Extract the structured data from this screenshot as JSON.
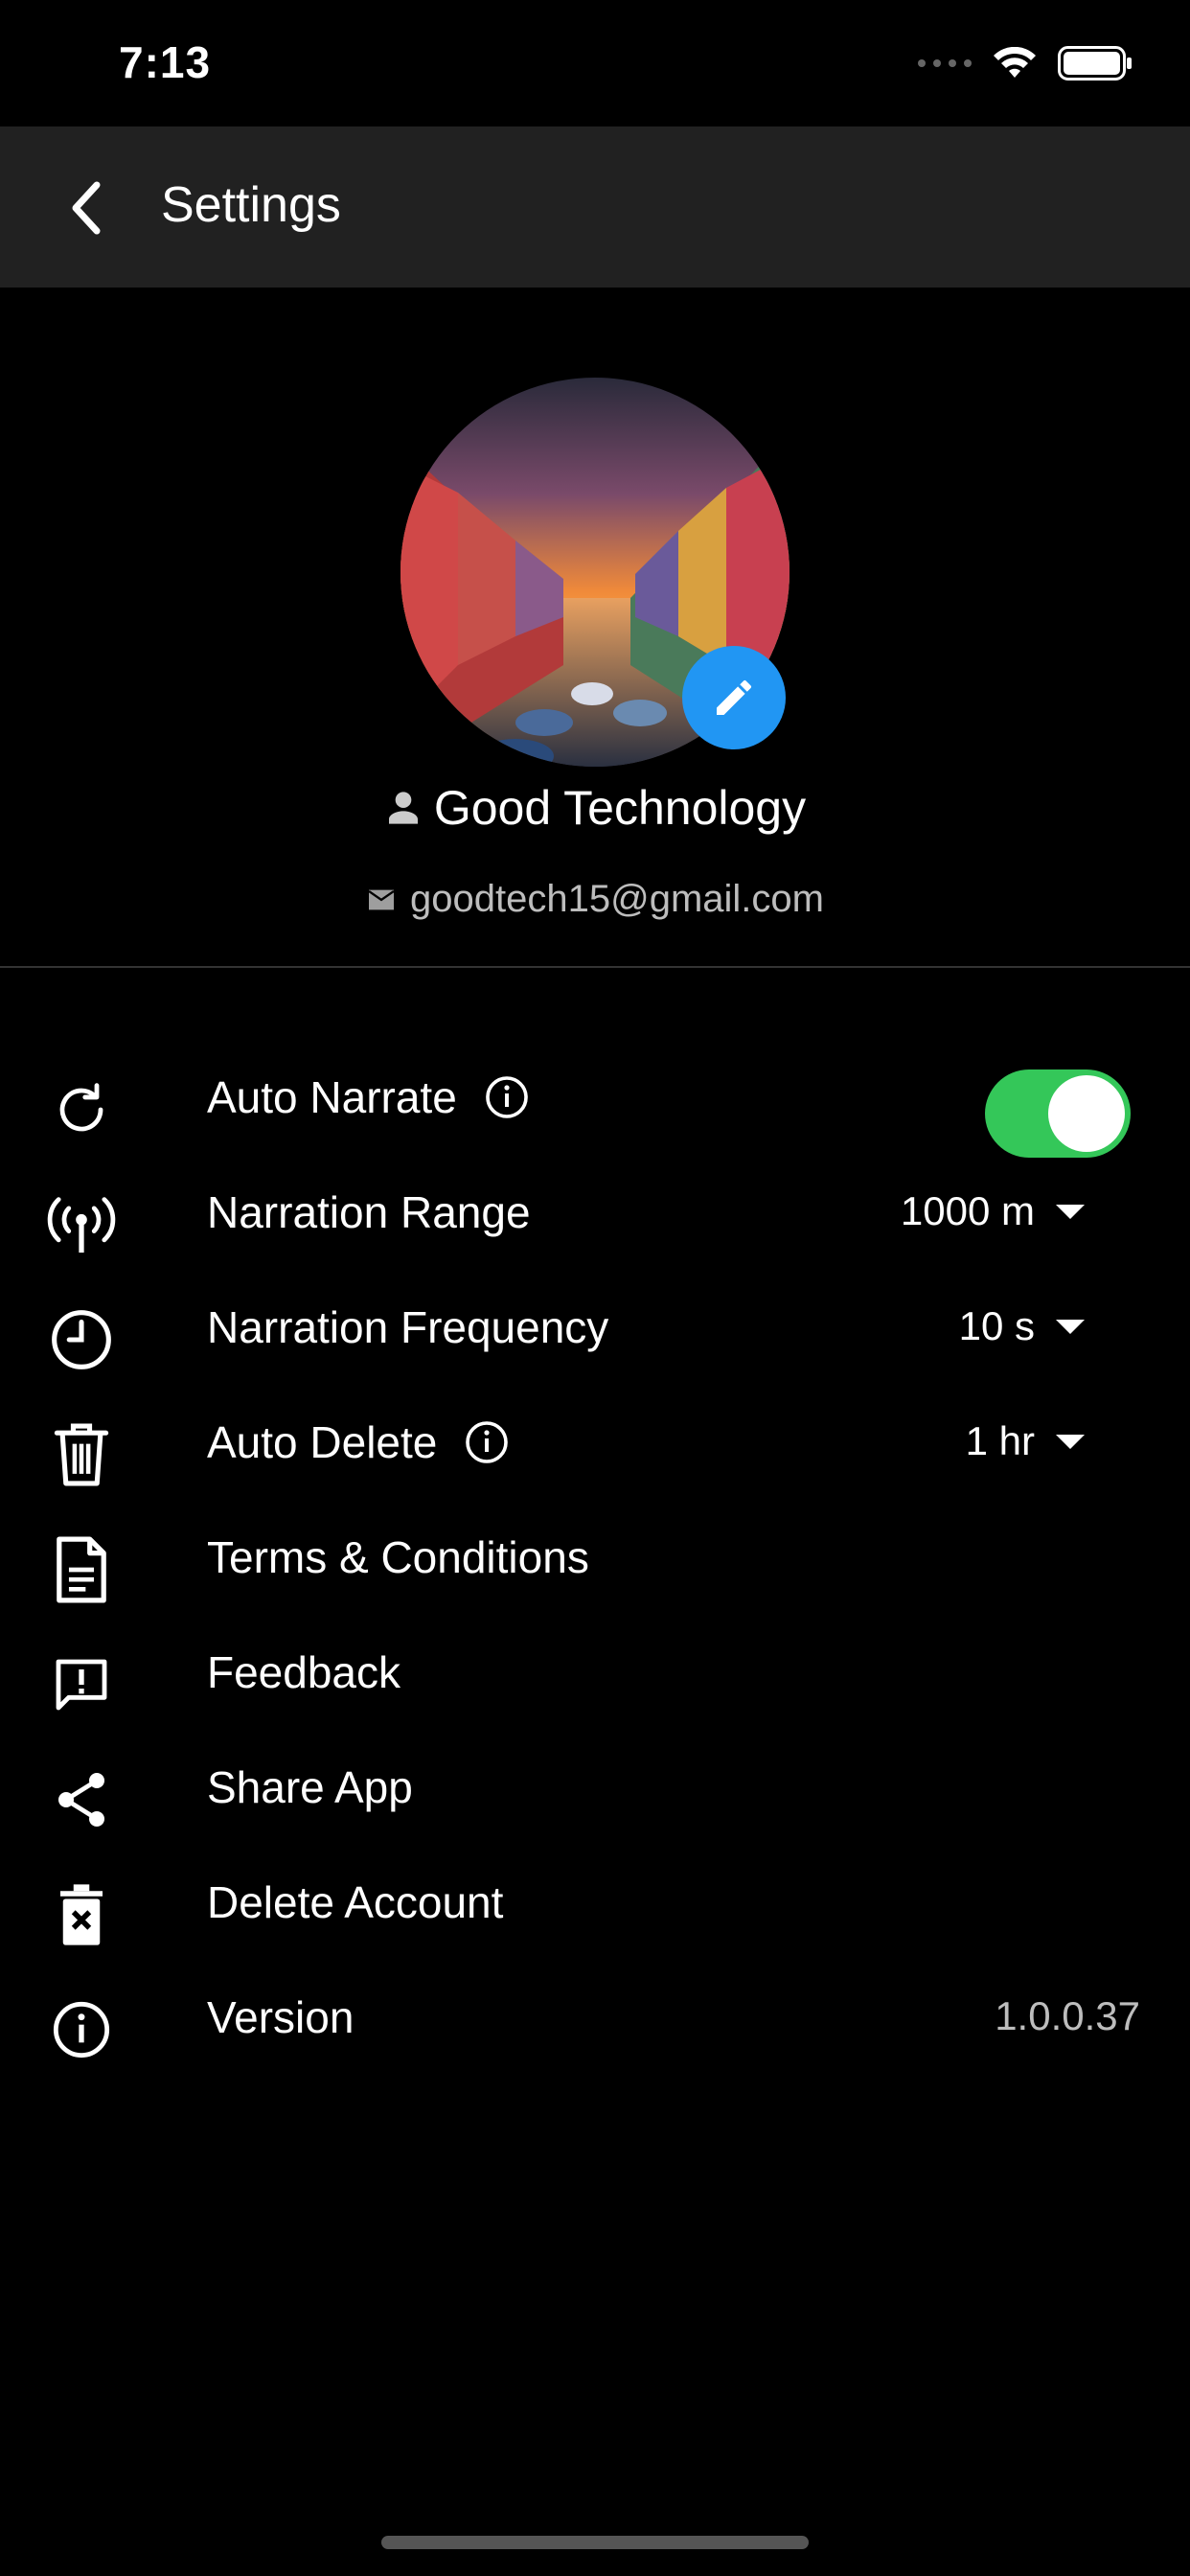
{
  "status_bar": {
    "time": "7:13"
  },
  "app_bar": {
    "title": "Settings"
  },
  "profile": {
    "name": "Good Technology",
    "email": "goodtech15@gmail.com"
  },
  "settings": {
    "auto_narrate": {
      "label": "Auto Narrate",
      "enabled": true
    },
    "narration_range": {
      "label": "Narration Range",
      "value": "1000 m"
    },
    "narration_frequency": {
      "label": "Narration Frequency",
      "value": "10 s"
    },
    "auto_delete": {
      "label": "Auto Delete",
      "value": "1 hr"
    },
    "terms": {
      "label": "Terms & Conditions"
    },
    "feedback": {
      "label": "Feedback"
    },
    "share": {
      "label": "Share App"
    },
    "delete_account": {
      "label": "Delete Account"
    },
    "version": {
      "label": "Version",
      "value": "1.0.0.37"
    }
  },
  "colors": {
    "accent": "#2196f3",
    "toggle_on": "#34c759",
    "app_bar": "#212121",
    "background": "#000000"
  },
  "icons": {
    "auto_narrate": "refresh-icon",
    "narration_range": "antenna-icon",
    "narration_frequency": "clock-icon",
    "auto_delete": "trash-icon",
    "terms": "document-icon",
    "feedback": "feedback-icon",
    "share": "share-icon",
    "delete_account": "delete-box-icon",
    "version": "info-icon"
  }
}
